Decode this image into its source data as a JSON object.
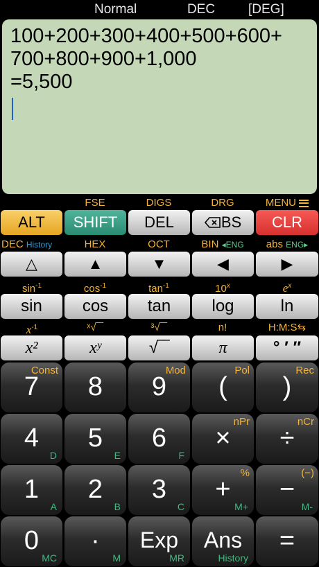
{
  "status": {
    "mode": "Normal",
    "base": "DEC",
    "angle": "[DEG]"
  },
  "display": {
    "line1": "100+200+300+400+500+600+",
    "line2": "700+800+900+1,000",
    "result": "=5,500"
  },
  "row1_labels": {
    "fse": "FSE",
    "digs": "DIGS",
    "drg": "DRG",
    "menu": "MENU"
  },
  "row1_keys": {
    "alt": "ALT",
    "shift": "SHIFT",
    "del": "DEL",
    "bs": "BS",
    "clr": "CLR"
  },
  "row2_labels": {
    "dec": "DEC",
    "history": "History",
    "hex": "HEX",
    "oct": "OCT",
    "bin": "BIN",
    "bin_eng": "◂ENG",
    "abs": "abs",
    "abs_eng": "ENG▸"
  },
  "row2_keys": {
    "k1": "△",
    "k2": "▲",
    "k3": "▼",
    "k4": "◀",
    "k5": "▶"
  },
  "row3_labels": {
    "asin": "sin",
    "acos": "cos",
    "atan": "tan",
    "inv": "-1",
    "tenx": "10",
    "x": "x",
    "ex": "e"
  },
  "row3_keys": {
    "sin": "sin",
    "cos": "cos",
    "tan": "tan",
    "log": "log",
    "ln": "ln"
  },
  "row4_labels": {
    "xinv": "x",
    "inv": "-1",
    "xroot": "ˣ√‾‾",
    "cbrt": "³√‾‾",
    "fact": "n!",
    "hms": "H:M:S⇆"
  },
  "row4_keys": {
    "x2": "x²",
    "xy": "xʸ",
    "sqrt": "√‾‾",
    "pi": "π",
    "dms": "° ′ ″"
  },
  "numpad": {
    "r1": [
      {
        "main": "7",
        "tr": "Const",
        "br": ""
      },
      {
        "main": "8",
        "tr": "",
        "br": ""
      },
      {
        "main": "9",
        "tr": "Mod",
        "br": ""
      },
      {
        "main": "(",
        "tr": "Pol",
        "br": ""
      },
      {
        "main": ")",
        "tr": "Rec",
        "br": ""
      }
    ],
    "r2": [
      {
        "main": "4",
        "tr": "",
        "br": "D"
      },
      {
        "main": "5",
        "tr": "",
        "br": "E"
      },
      {
        "main": "6",
        "tr": "",
        "br": "F"
      },
      {
        "main": "×",
        "tr": "nPr",
        "br": ""
      },
      {
        "main": "÷",
        "tr": "nCr",
        "br": ""
      }
    ],
    "r3": [
      {
        "main": "1",
        "tr": "",
        "br": "A"
      },
      {
        "main": "2",
        "tr": "",
        "br": "B"
      },
      {
        "main": "3",
        "tr": "",
        "br": "C"
      },
      {
        "main": "+",
        "tr": "%",
        "br": "M+"
      },
      {
        "main": "−",
        "tr": "(−)",
        "br": "M-"
      }
    ],
    "r4": [
      {
        "main": "0",
        "tr": "",
        "br": "MC"
      },
      {
        "main": "·",
        "tr": "",
        "br": "M"
      },
      {
        "main": "Exp",
        "tr": "",
        "br": "MR"
      },
      {
        "main": "Ans",
        "tr": "",
        "br": "History"
      },
      {
        "main": "=",
        "tr": "",
        "br": ""
      }
    ]
  }
}
